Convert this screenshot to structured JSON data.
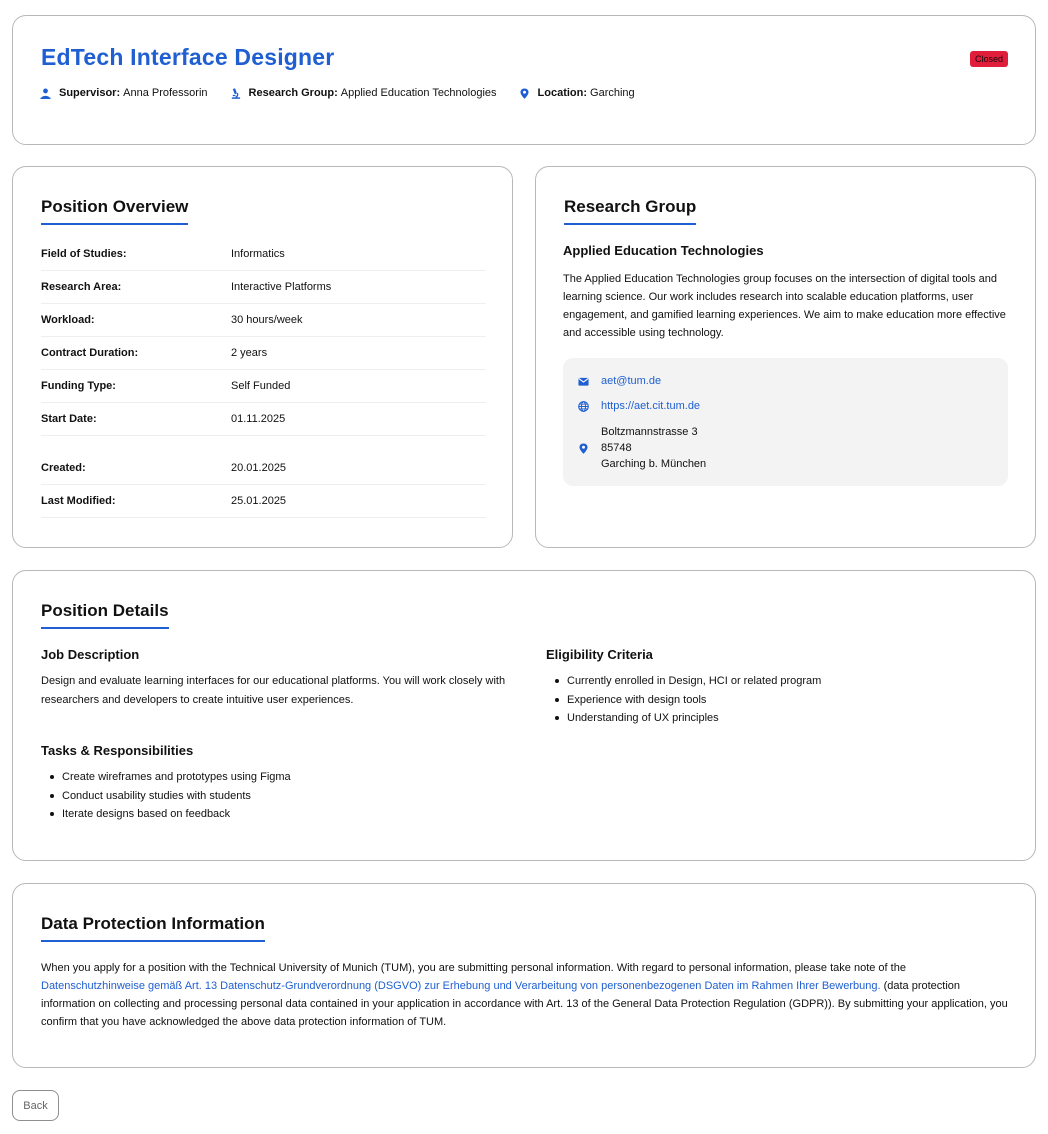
{
  "header": {
    "title": "EdTech Interface Designer",
    "status": "Closed",
    "status_color": "#e01e3c",
    "supervisor_label": "Supervisor:",
    "supervisor": "Anna Professorin",
    "research_group_label": "Research Group:",
    "research_group": "Applied Education Technologies",
    "location_label": "Location:",
    "location": "Garching",
    "icons": [
      "person-icon",
      "microscope-icon",
      "location-pin-icon"
    ]
  },
  "overview": {
    "heading": "Position Overview",
    "rows": [
      {
        "label": "Field of Studies:",
        "value": "Informatics"
      },
      {
        "label": "Research Area:",
        "value": "Interactive Platforms"
      },
      {
        "label": "Workload:",
        "value": "30 hours/week"
      },
      {
        "label": "Contract Duration:",
        "value": "2 years"
      },
      {
        "label": "Funding Type:",
        "value": "Self Funded"
      },
      {
        "label": "Start Date:",
        "value": "01.11.2025"
      },
      {
        "label": "Created:",
        "value": "20.01.2025"
      },
      {
        "label": "Last Modified:",
        "value": "25.01.2025"
      }
    ]
  },
  "research_group": {
    "heading": "Research Group",
    "name": "Applied Education Technologies",
    "description": "The Applied Education Technologies group focuses on the intersection of digital tools and learning science. Our work includes research into scalable education platforms, user engagement, and gamified learning experiences. We aim to make education more effective and accessible using technology.",
    "email": "aet@tum.de",
    "website": "https://aet.cit.tum.de",
    "address": [
      "Boltzmannstrasse 3",
      "85748",
      "Garching b. München"
    ],
    "icons": [
      "mail-icon",
      "globe-icon",
      "location-pin-icon"
    ]
  },
  "details": {
    "heading": "Position Details",
    "job_description_heading": "Job Description",
    "job_description": "Design and evaluate learning interfaces for our educational platforms. You will work closely with researchers and developers to create intuitive user experiences.",
    "tasks_heading": "Tasks & Responsibilities",
    "tasks": [
      "Create wireframes and prototypes using Figma",
      "Conduct usability studies with students",
      "Iterate designs based on feedback"
    ],
    "eligibility_heading": "Eligibility Criteria",
    "eligibility": [
      "Currently enrolled in Design, HCI or related program",
      "Experience with design tools",
      "Understanding of UX principles"
    ]
  },
  "data_protection": {
    "heading": "Data Protection Information",
    "text_before": "When you apply for a position with the Technical University of Munich (TUM), you are submitting personal information. With regard to personal information, please take note of the ",
    "link_text": "Datenschutzhinweise gemäß Art. 13 Datenschutz-Grundverordnung (DSGVO) zur Erhebung und Verarbeitung von personenbezogenen Daten im Rahmen Ihrer Bewerbung.",
    "text_after": " (data protection information on collecting and processing personal data contained in your application in accordance with Art. 13 of the General Data Protection Regulation (GDPR)). By submitting your application, you confirm that you have acknowledged the above data protection information of TUM."
  },
  "back_button": "Back",
  "accent_color": "#1f5fd1"
}
